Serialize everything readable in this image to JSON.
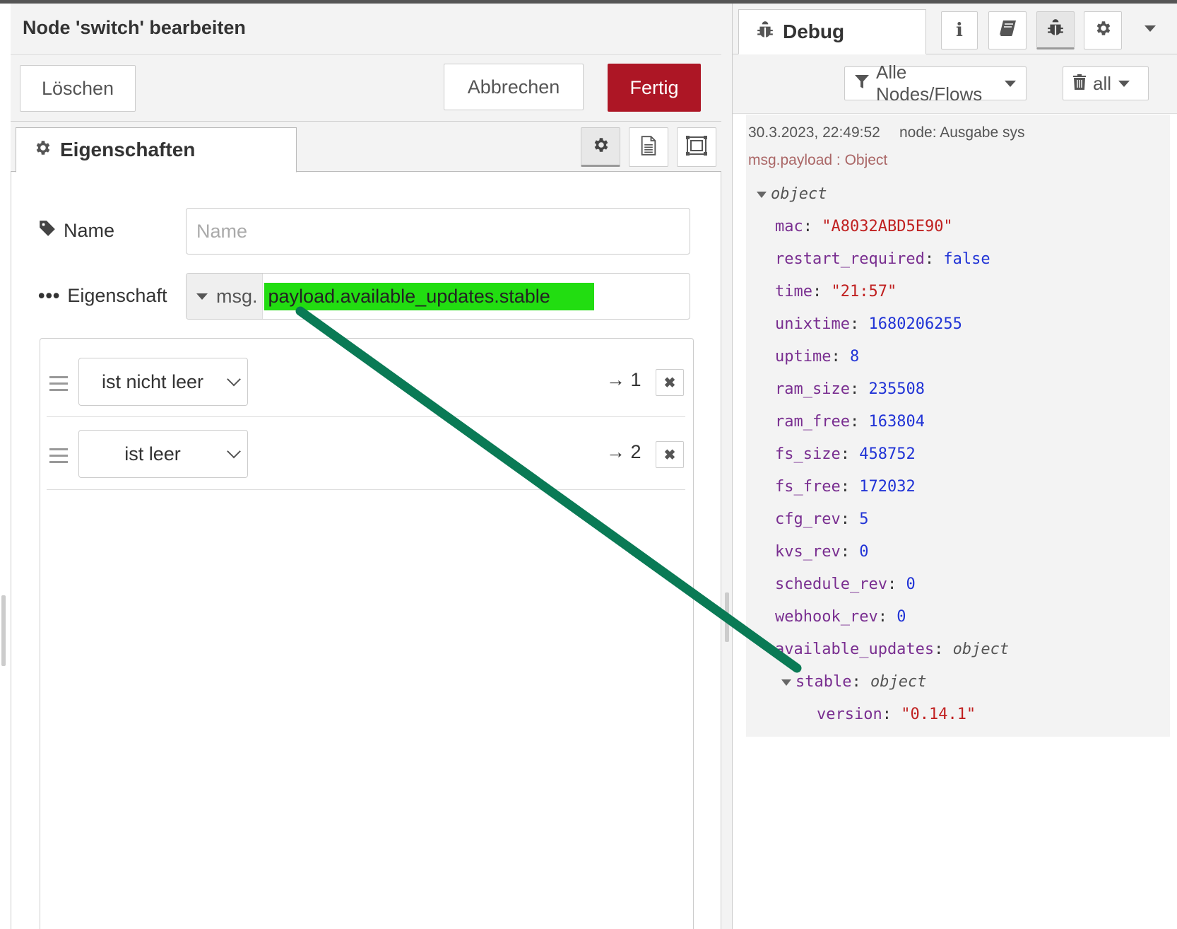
{
  "editor": {
    "title": "Node 'switch' bearbeiten",
    "delete_label": "Löschen",
    "cancel_label": "Abbrechen",
    "done_label": "Fertig",
    "tab_properties": "Eigenschaften",
    "name_label": "Name",
    "name_placeholder": "Name",
    "property_label": "Eigenschaft",
    "property_prefix": "msg.",
    "property_value": "payload.available_updates.stable",
    "rules": [
      {
        "operator": "ist nicht leer",
        "port": "→ 1"
      },
      {
        "operator": "ist leer",
        "port": "→ 2"
      }
    ],
    "delete_rule_glyph": "✖"
  },
  "sidebar": {
    "tab_label": "Debug",
    "filter_label": "Alle Nodes/Flows",
    "clear_label": "all",
    "message": {
      "timestamp": "30.3.2023, 22:49:52",
      "source": "node: Ausgabe sys",
      "topic": "msg.payload : Object",
      "root_type": "object",
      "fields": [
        {
          "key": "mac",
          "value": "\"A8032ABD5E90\"",
          "kind": "str"
        },
        {
          "key": "restart_required",
          "value": "false",
          "kind": "bool"
        },
        {
          "key": "time",
          "value": "\"21:57\"",
          "kind": "str"
        },
        {
          "key": "unixtime",
          "value": "1680206255",
          "kind": "num"
        },
        {
          "key": "uptime",
          "value": "8",
          "kind": "num"
        },
        {
          "key": "ram_size",
          "value": "235508",
          "kind": "num"
        },
        {
          "key": "ram_free",
          "value": "163804",
          "kind": "num"
        },
        {
          "key": "fs_size",
          "value": "458752",
          "kind": "num"
        },
        {
          "key": "fs_free",
          "value": "172032",
          "kind": "num"
        },
        {
          "key": "cfg_rev",
          "value": "5",
          "kind": "num"
        },
        {
          "key": "kvs_rev",
          "value": "0",
          "kind": "num"
        },
        {
          "key": "schedule_rev",
          "value": "0",
          "kind": "num"
        },
        {
          "key": "webhook_rev",
          "value": "0",
          "kind": "num"
        },
        {
          "key": "available_updates",
          "value": "object",
          "kind": "typ"
        }
      ],
      "nested_key": "stable",
      "nested_type": "object",
      "leaf_key": "version",
      "leaf_value": "\"0.14.1\""
    }
  },
  "colors": {
    "done_button": "#ad1625",
    "highlight": "#22dd11",
    "annotation_line": "#0a7a55",
    "key": "#792e90",
    "string": "#c02020",
    "number": "#2033d6"
  }
}
